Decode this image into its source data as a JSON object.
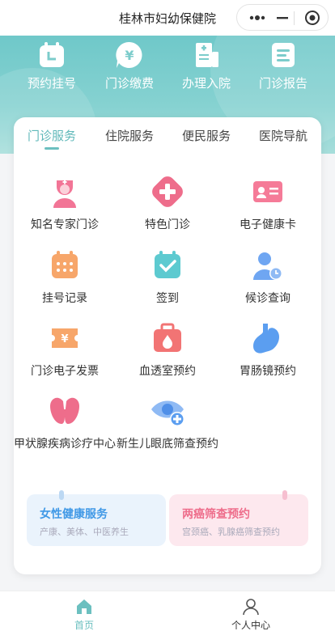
{
  "app": {
    "title": "桂林市妇幼保健院"
  },
  "quick_actions": [
    {
      "label": "预约挂号",
      "icon": "calendar-icon"
    },
    {
      "label": "门诊缴费",
      "icon": "yuan-payment-icon"
    },
    {
      "label": "办理入院",
      "icon": "admission-document-icon"
    },
    {
      "label": "门诊报告",
      "icon": "report-icon"
    }
  ],
  "tabs": [
    {
      "label": "门诊服务",
      "active": true
    },
    {
      "label": "住院服务",
      "active": false
    },
    {
      "label": "便民服务",
      "active": false
    },
    {
      "label": "医院导航",
      "active": false
    }
  ],
  "services": [
    {
      "label": "知名专家门诊",
      "icon": "nurse-icon",
      "color": "#f27596"
    },
    {
      "label": "特色门诊",
      "icon": "medical-cross-icon",
      "color": "#ee6d8b"
    },
    {
      "label": "电子健康卡",
      "icon": "health-card-icon",
      "color": "#f57b98"
    },
    {
      "label": "挂号记录",
      "icon": "calendar-grid-icon",
      "color": "#f7a66a"
    },
    {
      "label": "签到",
      "icon": "checkin-icon",
      "color": "#5dcad0"
    },
    {
      "label": "候诊查询",
      "icon": "queue-clock-icon",
      "color": "#6fa6f2"
    },
    {
      "label": "门诊电子发票",
      "icon": "invoice-ticket-icon",
      "color": "#f7a66a"
    },
    {
      "label": "血透室预约",
      "icon": "medical-kit-icon",
      "color": "#f27474"
    },
    {
      "label": "胃肠镜预约",
      "icon": "stomach-icon",
      "color": "#5b9ef0"
    },
    {
      "label": "甲状腺疾病诊疗中心",
      "icon": "thyroid-icon",
      "color": "#ee6d8b"
    },
    {
      "label": "新生儿眼底筛查预约",
      "icon": "eye-plus-icon",
      "color": "#6fa6f2"
    }
  ],
  "promos": [
    {
      "title": "女性健康服务",
      "subtitle": "产康、美体、中医养生",
      "color": "#3f98e6"
    },
    {
      "title": "两癌筛查预约",
      "subtitle": "宫颈癌、乳腺癌筛查预约",
      "color": "#ee6d8b"
    }
  ],
  "bottom_nav": [
    {
      "label": "首页",
      "icon": "home-icon",
      "active": true
    },
    {
      "label": "个人中心",
      "icon": "user-icon",
      "active": false
    }
  ],
  "colors": {
    "accent": "#6cc0c0",
    "banner": "#78cbcb"
  }
}
